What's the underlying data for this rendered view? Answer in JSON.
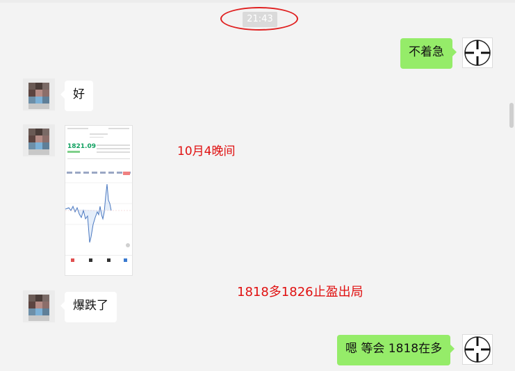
{
  "chat": {
    "timestamp": "21:43",
    "messages": [
      {
        "side": "right",
        "text": "不着急"
      },
      {
        "side": "left",
        "text": "好"
      },
      {
        "side": "left",
        "type": "image"
      },
      {
        "side": "left",
        "text": "爆跌了"
      },
      {
        "side": "right",
        "text": "嗯  等会 1818在多"
      }
    ]
  },
  "annotations": {
    "note1": "10月4晚间",
    "note2": "1818多1826止盈出局"
  },
  "phone_screenshot": {
    "price": "1821.09"
  },
  "colors": {
    "background": "#f3f3f3",
    "bubble_right": "#95ec69",
    "bubble_left": "#ffffff",
    "annotation_red": "#e01010",
    "chart_line": "#4a78c0"
  },
  "icons": [
    "crosshair-avatar-icon",
    "blurred-avatar"
  ]
}
